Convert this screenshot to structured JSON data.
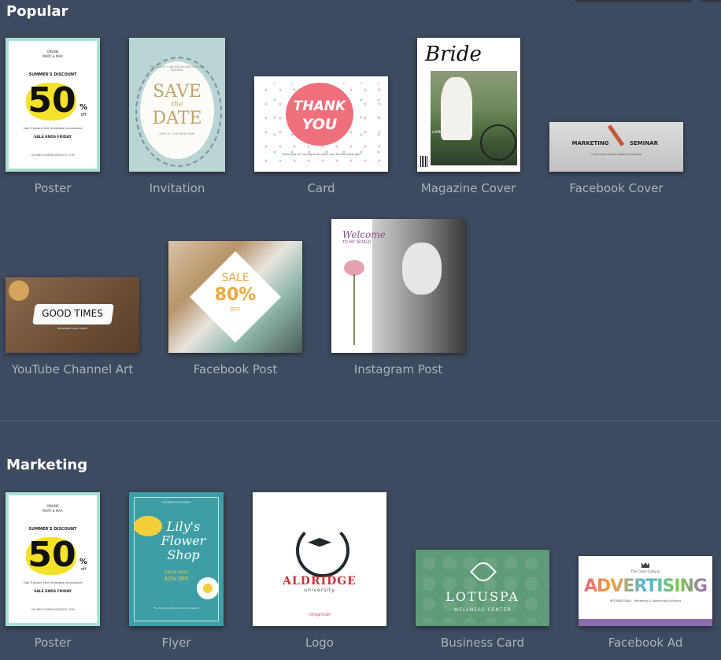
{
  "sections": {
    "popular": {
      "title": "Popular",
      "items": [
        {
          "label": "Poster"
        },
        {
          "label": "Invitation"
        },
        {
          "label": "Card"
        },
        {
          "label": "Magazine Cover"
        },
        {
          "label": "Facebook Cover"
        },
        {
          "label": "YouTube Channel Art"
        },
        {
          "label": "Facebook Post"
        },
        {
          "label": "Instagram Post"
        }
      ]
    },
    "marketing": {
      "title": "Marketing",
      "items": [
        {
          "label": "Poster"
        },
        {
          "label": "Flyer"
        },
        {
          "label": "Logo"
        },
        {
          "label": "Business Card"
        },
        {
          "label": "Facebook Ad"
        }
      ]
    }
  },
  "art": {
    "poster": {
      "line1": "ONLINE",
      "line2": "MARY & MAX",
      "headline": "SUMMER'S DISCOUNT",
      "big": "50",
      "pct": "%",
      "off": "off",
      "cats": "Coat   Trousers   Skirt   Underwear   Accessories",
      "foot": "SALE ENDS FRIDAY",
      "url": "ONLINECOMPANYWEBSITE.COM"
    },
    "invitation": {
      "top": "MARGARET & NICHOLAS ARE GETTING MARRIED",
      "save": "SAVE",
      "the": "the",
      "date": "DATE",
      "when": "JUNE 20, 2018  NEW YORK"
    },
    "card": {
      "thank": "THANK",
      "you": "YOU",
      "msg": "Thank you for coming to my party and for the lovely gift!"
    },
    "magazine": {
      "title": "Bride",
      "side": "LAWN"
    },
    "fbcover": {
      "a": "MARKETING",
      "b": "SEMINAR",
      "sub": "HOW TO BE A GREAT PRODUCT MANAGER"
    },
    "youtube": {
      "text": "GOOD TIMES",
      "sub": "REMEMBER GOOD TIMES"
    },
    "fbpost": {
      "sale": "SALE",
      "pct": "80%",
      "off": "OFF"
    },
    "instagram": {
      "welcome": "Welcome",
      "to": "TO MY WORLD"
    },
    "flyer": {
      "top": "FLOWERS & PLANTS",
      "l1": "Lily's",
      "l2": "Flower",
      "l3": "Shop",
      "offer1": "SPECIAL OFFER",
      "offer2": "30% OFF",
      "addr": "The Best Lakeside Community Market"
    },
    "logo": {
      "name": "ALDRIDGE",
      "sub": "university",
      "url": "FOTOJET.COM"
    },
    "bizcard": {
      "name": "LOTUSPA",
      "sub": "WELLNESS CENTER"
    },
    "fbad": {
      "top": "The Cross-Cultural",
      "word": "ADVERTISING",
      "sub": "INTERNATIONAL · Marketing & Advertising Solutions"
    }
  }
}
